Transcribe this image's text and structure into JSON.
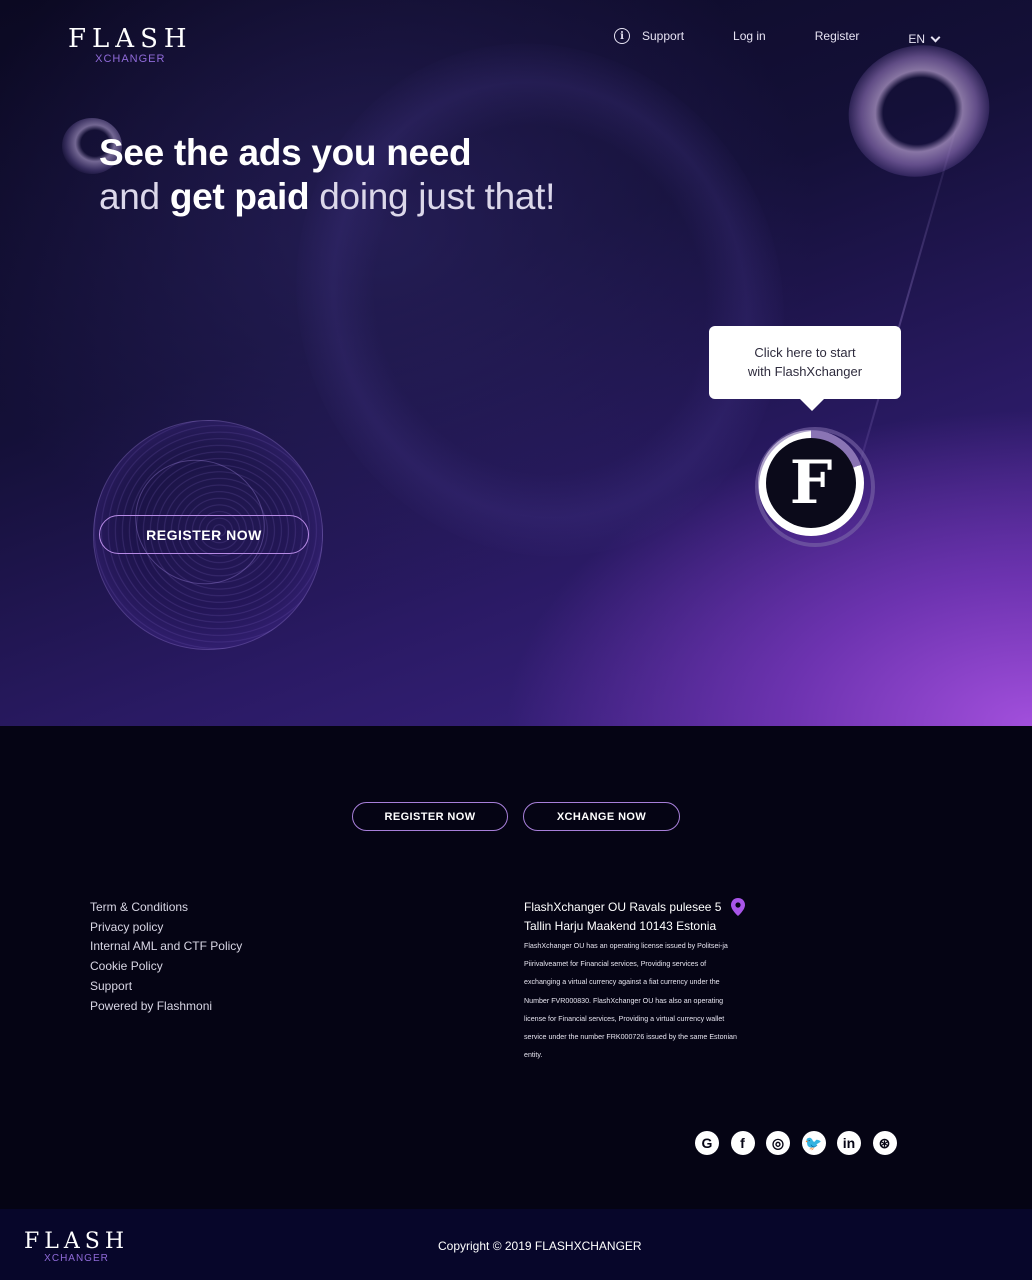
{
  "brand": {
    "name": "FLASH",
    "tagline": "XCHANGER"
  },
  "nav": {
    "support": "Support",
    "login": "Log in",
    "register": "Register",
    "language": "EN"
  },
  "hero": {
    "headline_line1": "See the ads you need",
    "headline_line2_pre": "and ",
    "headline_line2_bold": "get paid",
    "headline_line2_post": " doing just that!",
    "register_button": "REGISTER NOW",
    "tooltip_line1": "Click here to start",
    "tooltip_line2": "with FlashXchanger",
    "badge_letter": "F"
  },
  "cta": {
    "register": "REGISTER NOW",
    "xchange": "XCHANGE NOW"
  },
  "footer_links": [
    "Term & Conditions",
    "Privacy policy",
    "Internal AML and CTF Policy",
    "Cookie Policy",
    "Support",
    "Powered by Flashmoni"
  ],
  "address": {
    "line1": "FlashXchanger OU Ravals pulesee 5",
    "line2": "Tallin Harju Maakend 10143 Estonia",
    "description": "FlashXchanger OU has an operating license issued by Politsei-ja Piirivalveamet for Financial services, Providing services of exchanging a virtual currency against a fiat currency under the Number FVR000830. FlashXchanger OU has also an operating license for Financial services, Providing a virtual currency wallet service under the number FRK000726 issued by the same Estonian entity."
  },
  "socials": [
    {
      "icon": "google-icon",
      "glyph": "G"
    },
    {
      "icon": "facebook-icon",
      "glyph": "f"
    },
    {
      "icon": "instagram-icon",
      "glyph": "◎"
    },
    {
      "icon": "twitter-icon",
      "glyph": "🐦"
    },
    {
      "icon": "linkedin-icon",
      "glyph": "in"
    },
    {
      "icon": "dribbble-icon",
      "glyph": "⊛"
    }
  ],
  "copyright": "Copyright © 2019 FLASHXCHANGER",
  "colors": {
    "accent": "#a77fd9",
    "pin": "#a855e8",
    "hero_glow": "#a24fdc"
  }
}
